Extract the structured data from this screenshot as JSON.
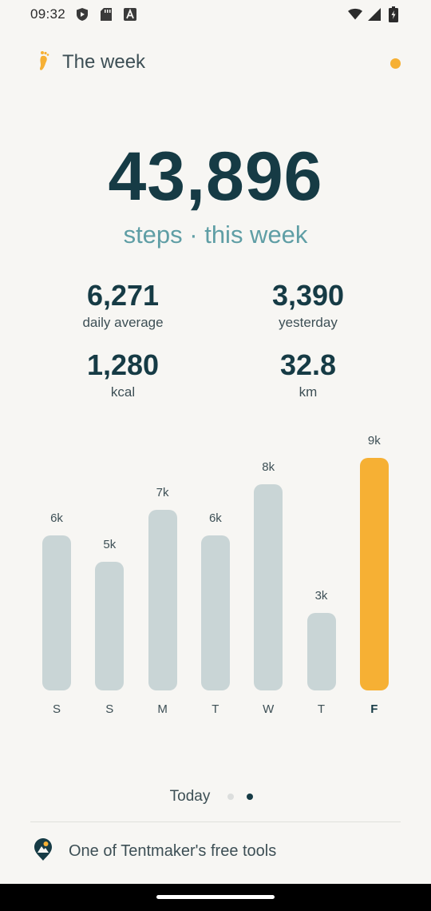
{
  "status": {
    "time": "09:32",
    "icons": [
      "shield-icon",
      "sd-card-icon",
      "font-icon",
      "wifi-icon",
      "signal-icon",
      "battery-icon"
    ]
  },
  "header": {
    "title": "The week",
    "icon": "footprint-icon",
    "accent_color": "#f6b034"
  },
  "summary": {
    "total_steps": "43,896",
    "caption": "steps · this week"
  },
  "stats": {
    "daily_average": {
      "value": "6,271",
      "label": "daily average"
    },
    "yesterday": {
      "value": "3,390",
      "label": "yesterday"
    },
    "kcal": {
      "value": "1,280",
      "label": "kcal"
    },
    "km": {
      "value": "32.8",
      "label": "km"
    }
  },
  "chart_data": {
    "type": "bar",
    "categories": [
      "S",
      "S",
      "M",
      "T",
      "W",
      "T",
      "F"
    ],
    "values": [
      6,
      5,
      7,
      6,
      8,
      3,
      9
    ],
    "value_labels": [
      "6k",
      "5k",
      "7k",
      "6k",
      "8k",
      "3k",
      "9k"
    ],
    "highlight_index": 6,
    "ylim": [
      0,
      9.6
    ],
    "colors": {
      "bar": "#c9d5d6",
      "highlight": "#f6b034"
    }
  },
  "pager": {
    "label": "Today",
    "active_index": 1,
    "count": 2
  },
  "footer": {
    "text": "One of Tentmaker's free tools",
    "icon": "tentmaker-logo-icon"
  }
}
